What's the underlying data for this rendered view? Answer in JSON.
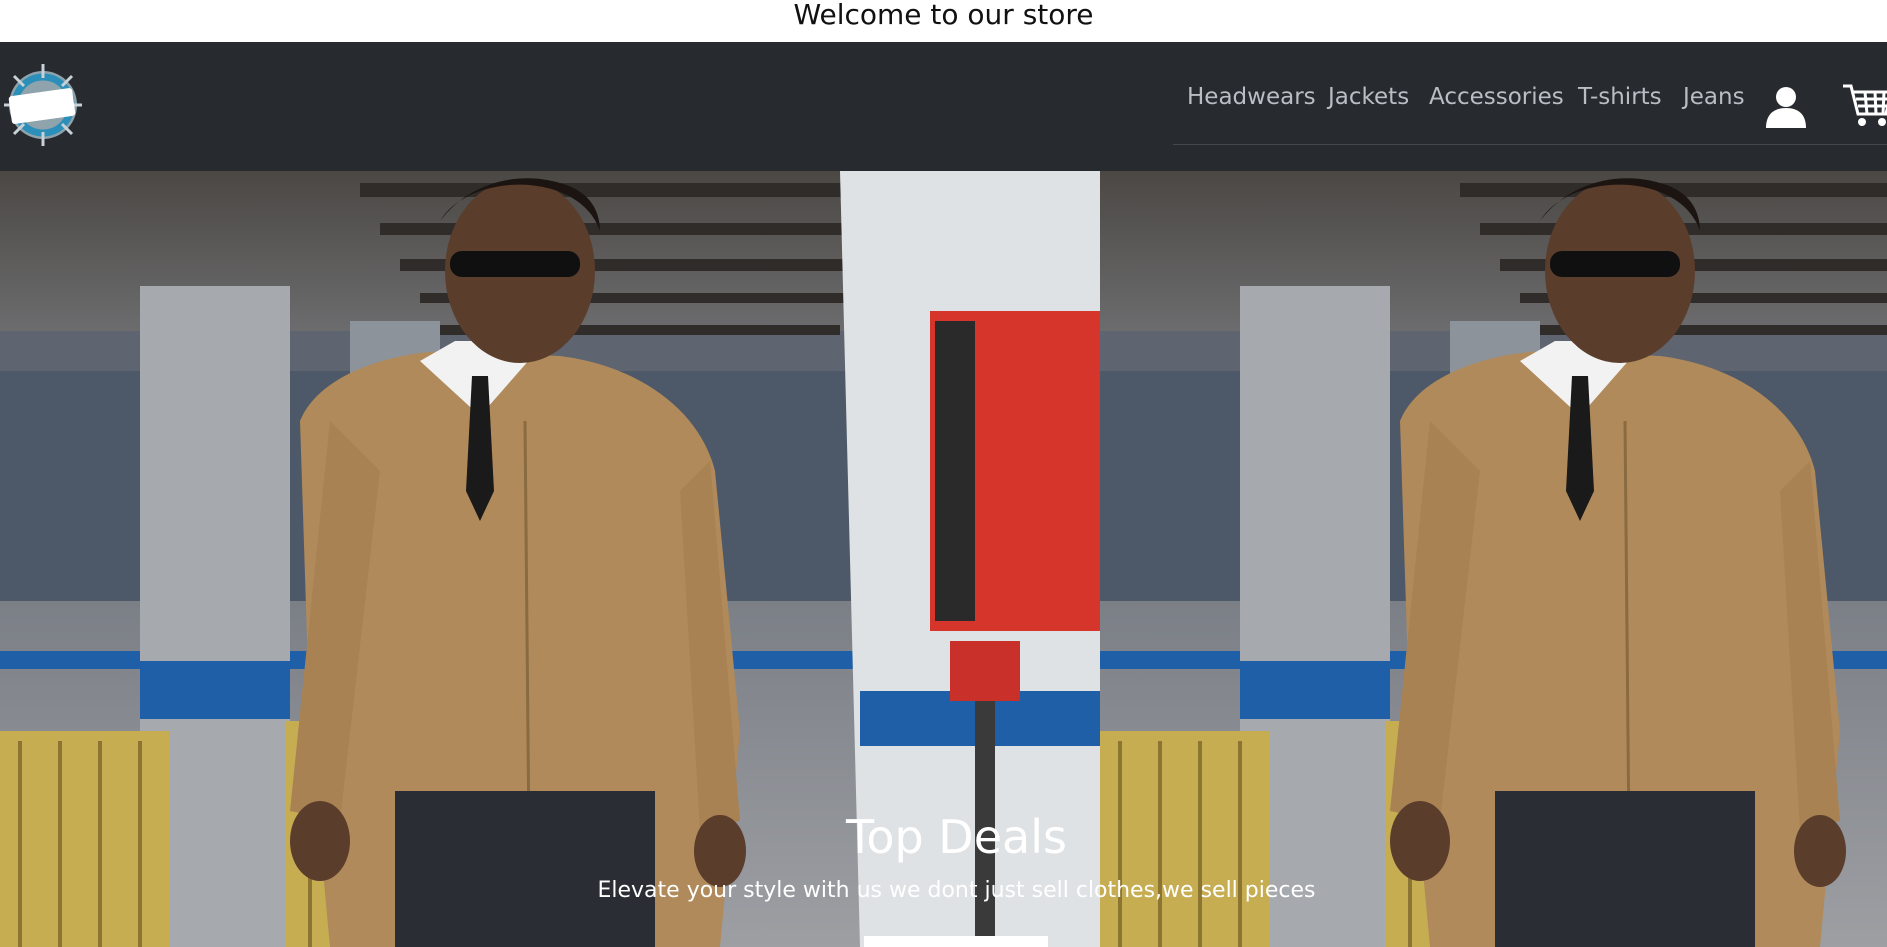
{
  "banner": {
    "text": "Welcome to our store"
  },
  "navbar": {
    "links": [
      {
        "label": "Headwears"
      },
      {
        "label": "Jackets"
      },
      {
        "label": "Accessories"
      },
      {
        "label": "T-shirts"
      },
      {
        "label": "Jeans"
      }
    ],
    "icons": [
      "user-icon",
      "cart-icon"
    ]
  },
  "hero": {
    "title": "Top Deals",
    "subtitle": "Elevate your style with us we dont just sell clothes,we sell pieces",
    "button_label": ""
  },
  "colors": {
    "navbar_bg": "#272b30",
    "nav_link": "#b9bec4",
    "jacket": "#b08a5a",
    "accent_blue": "#1f5fa8",
    "red_box": "#d6352b"
  }
}
